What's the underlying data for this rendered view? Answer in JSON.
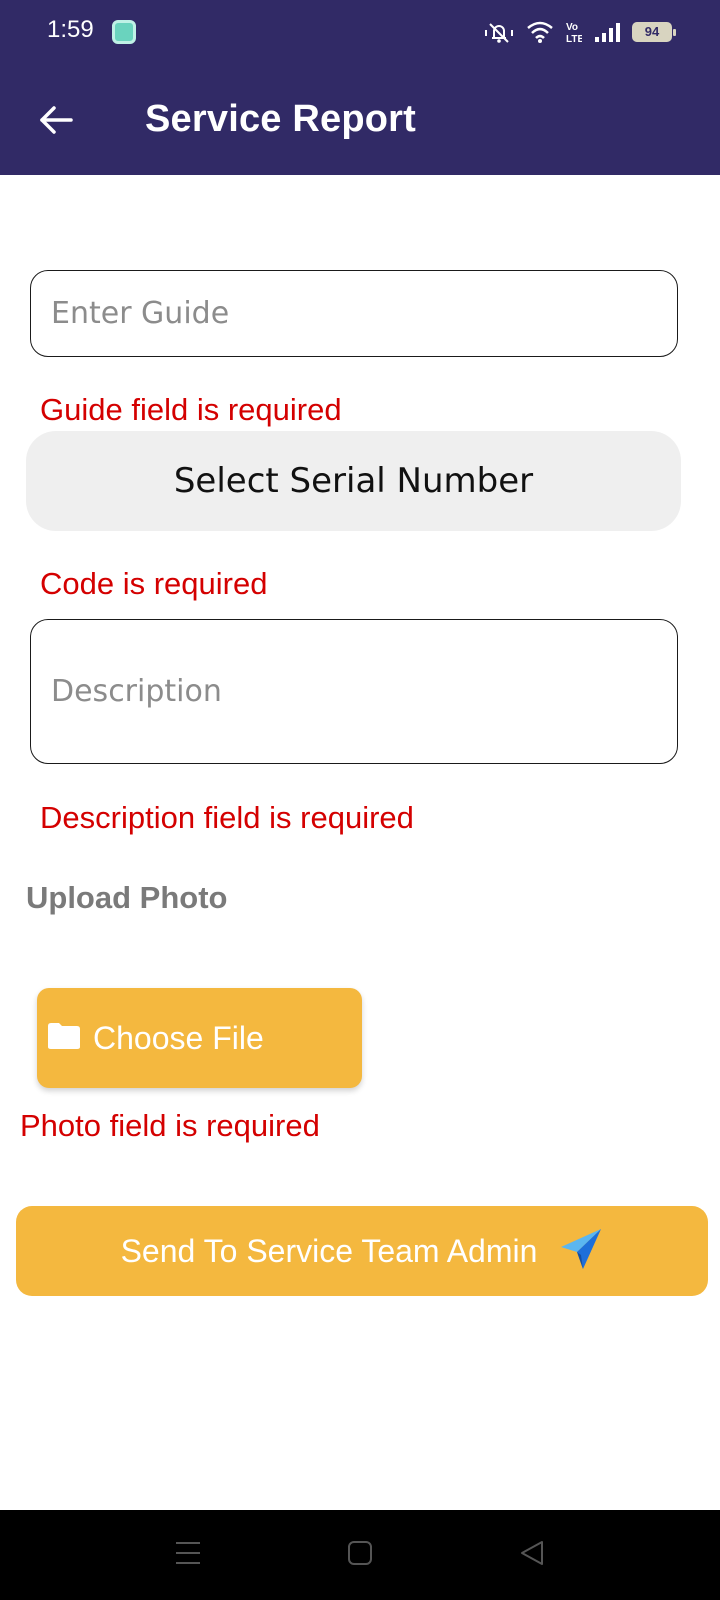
{
  "status_bar": {
    "time": "1:59",
    "battery_level": "94",
    "icons": [
      "app-notification-icon",
      "mute-bell-icon",
      "wifi-icon",
      "volte-icon",
      "signal-icon",
      "battery-icon"
    ]
  },
  "header": {
    "title": "Service Report",
    "back_icon": "arrow-left-icon",
    "background_color": "#312a66"
  },
  "form": {
    "guide_placeholder": "Enter Guide",
    "guide_value": "",
    "guide_error": "Guide field is required",
    "serial_select_label": "Select Serial Number",
    "code_error": "Code is required",
    "description_placeholder": "Description",
    "description_value": "",
    "description_error": "Description field is required",
    "upload_label": "Upload Photo",
    "choose_file_label": "Choose File",
    "photo_error": "Photo field is required",
    "submit_label": "Send To Service Team Admin"
  },
  "colors": {
    "accent": "#f4b83f",
    "error": "#d40000",
    "header": "#312a66"
  },
  "nav_bar": {
    "buttons": [
      "menu-icon",
      "home-square-icon",
      "back-triangle-icon"
    ]
  }
}
